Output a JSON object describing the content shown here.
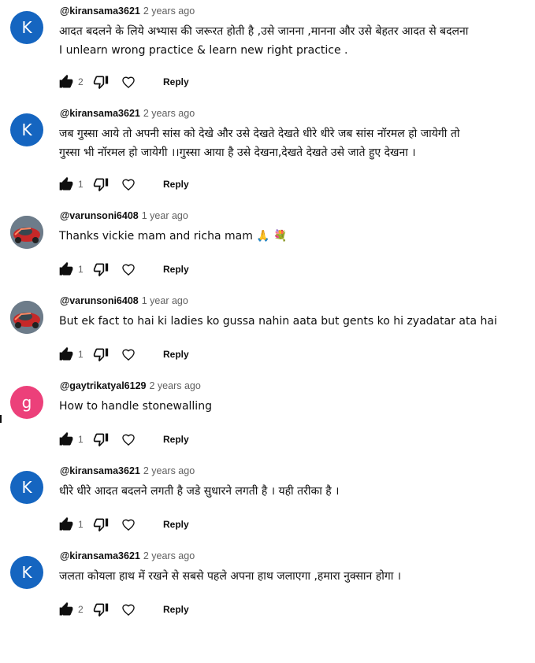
{
  "colors": {
    "avatar_k": "#1565c0",
    "avatar_g": "#ec407a",
    "text_primary": "#0f0f0f",
    "text_secondary": "#606060"
  },
  "icons": {
    "like": "thumbs-up-icon",
    "dislike": "thumbs-down-icon",
    "heart": "heart-icon"
  },
  "comments": [
    {
      "avatar_letter": "K",
      "author": "@kiransama3621",
      "time": "2 years ago",
      "text": "आदत बदलने के लिये अभ्यास की जरूरत होती है ,उसे जानना ,मानना और उसे बेहतर आदत से बदलना\n I unlearn  wrong practice & learn new right practice .",
      "likes": "2",
      "reply_label": "Reply"
    },
    {
      "avatar_letter": "K",
      "author": "@kiransama3621",
      "time": "2 years ago",
      "text": "जब गुस्सा आये तो अपनी सांस को देखे और उसे देखते देखते धीरे धीरे  जब सांस नॉरमल हो जायेगी तो\nगुस्सा भी नॉरमल हो जायेगी ।।गुस्सा आया है उसे देखना,देखते  देखते उसे जाते हुए देखना ।",
      "likes": "1",
      "reply_label": "Reply"
    },
    {
      "avatar_letter": "",
      "author": "@varunsoni6408",
      "time": "1 year ago",
      "text": "Thanks vickie mam and richa mam 🙏 💐",
      "likes": "1",
      "reply_label": "Reply"
    },
    {
      "avatar_letter": "",
      "author": "@varunsoni6408",
      "time": "1 year ago",
      "text": "But ek fact to hai ki ladies ko gussa nahin aata but gents ko hi zyadatar ata hai",
      "likes": "1",
      "reply_label": "Reply"
    },
    {
      "avatar_letter": "g",
      "author": "@gaytrikatyal6129",
      "time": "2 years ago",
      "text": "How to handle stonewalling",
      "likes": "1",
      "reply_label": "Reply"
    },
    {
      "avatar_letter": "K",
      "author": "@kiransama3621",
      "time": "2 years ago",
      "text": "धीरे धीरे आदत बदलने लगती है  जडे सुधारने लगती है । यही तरीका है ।",
      "likes": "1",
      "reply_label": "Reply"
    },
    {
      "avatar_letter": "K",
      "author": "@kiransama3621",
      "time": "2 years ago",
      "text": "जलता कोयला हाथ में  रखने से सबसे पहले अपना हाथ जलाएगा ,हमारा नुक्सान होगा ।",
      "likes": "2",
      "reply_label": "Reply"
    }
  ]
}
